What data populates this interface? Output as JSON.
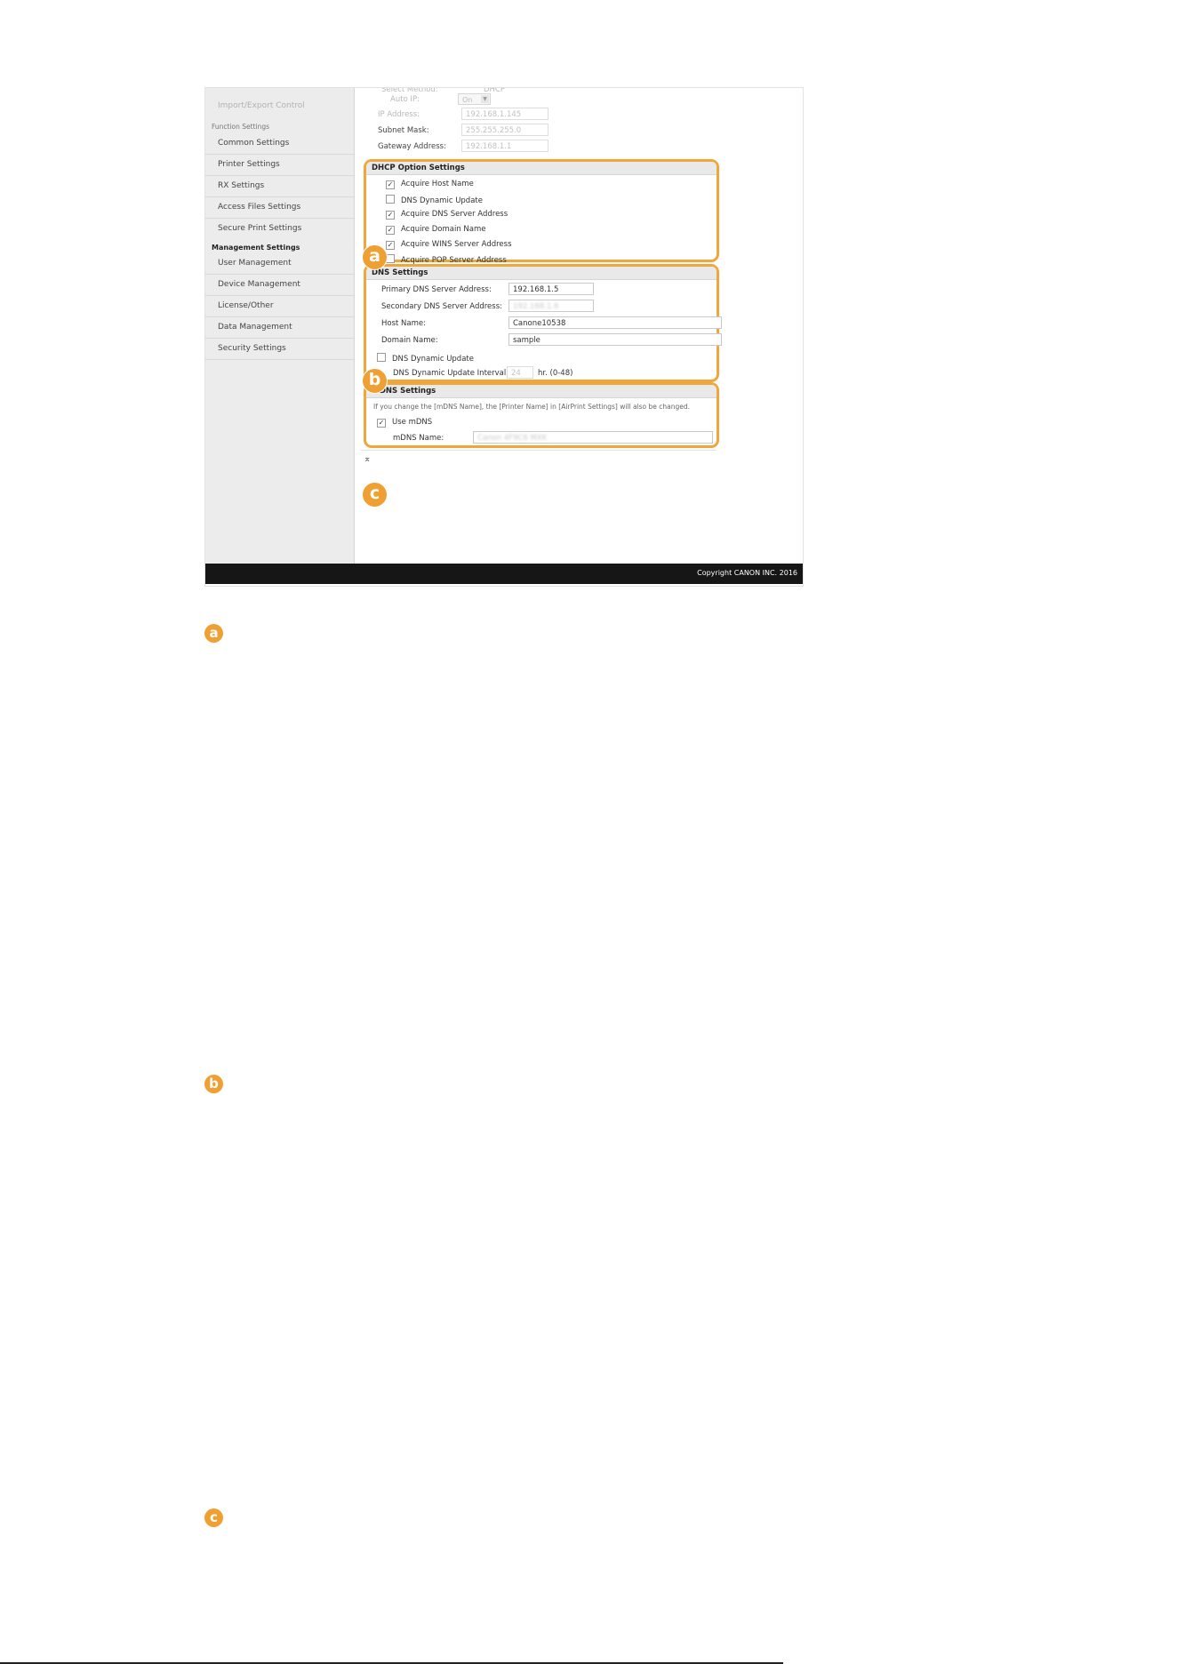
{
  "sidebar": {
    "top_item": "Import/Export Control",
    "function_heading": "Function Settings",
    "function_items": [
      "Common Settings",
      "Printer Settings",
      "RX Settings",
      "Access Files Settings",
      "Secure Print Settings"
    ],
    "management_heading": "Management Settings",
    "management_items": [
      "User Management",
      "Device Management",
      "License/Other",
      "Data Management",
      "Security Settings"
    ]
  },
  "ipv4": {
    "faded_top_label": "Select Method:",
    "faded_top_value": "DHCP",
    "auto_ip_label": "Auto IP:",
    "auto_ip_value": "On",
    "ip_label": "IP Address:",
    "ip_value": "192.168.1.145",
    "subnet_label": "Subnet Mask:",
    "subnet_value": "255.255.255.0",
    "gateway_label": "Gateway Address:",
    "gateway_value": "192.168.1.1"
  },
  "dhcp": {
    "title": "DHCP Option Settings",
    "options": [
      {
        "label": "Acquire Host Name",
        "checked": true
      },
      {
        "label": "DNS Dynamic Update",
        "checked": false
      },
      {
        "label": "Acquire DNS Server Address",
        "checked": true
      },
      {
        "label": "Acquire Domain Name",
        "checked": true
      },
      {
        "label": "Acquire WINS Server Address",
        "checked": true
      },
      {
        "label": "Acquire POP Server Address",
        "checked": false
      }
    ]
  },
  "dns": {
    "title": "DNS Settings",
    "primary_label": "Primary DNS Server Address:",
    "primary_value": "192.168.1.5",
    "secondary_label": "Secondary DNS Server Address:",
    "secondary_value": "192.168.1.6",
    "host_label": "Host Name:",
    "host_value": "Canone10538",
    "domain_label": "Domain Name:",
    "domain_value": "sample",
    "dyn_update_label": "DNS Dynamic Update",
    "interval_label": "DNS Dynamic Update Interval:",
    "interval_value": "24",
    "interval_unit": "hr. (0-48)"
  },
  "mdns": {
    "title": "mDNS Settings",
    "note": "If you change the [mDNS Name], the [Printer Name] in [AirPrint Settings] will also be changed.",
    "use_label": "Use mDNS",
    "name_label": "mDNS Name:",
    "name_value": "Canon 4F9C6 MXK"
  },
  "markers": {
    "a": "a",
    "b": "b",
    "c": "c"
  },
  "top_icon": "⌅",
  "footer": {
    "copyright": "Copyright CANON INC. 2016"
  },
  "colors": {
    "highlight": "#f0a63a",
    "marker": "#f0a032",
    "footer": "#161616"
  }
}
